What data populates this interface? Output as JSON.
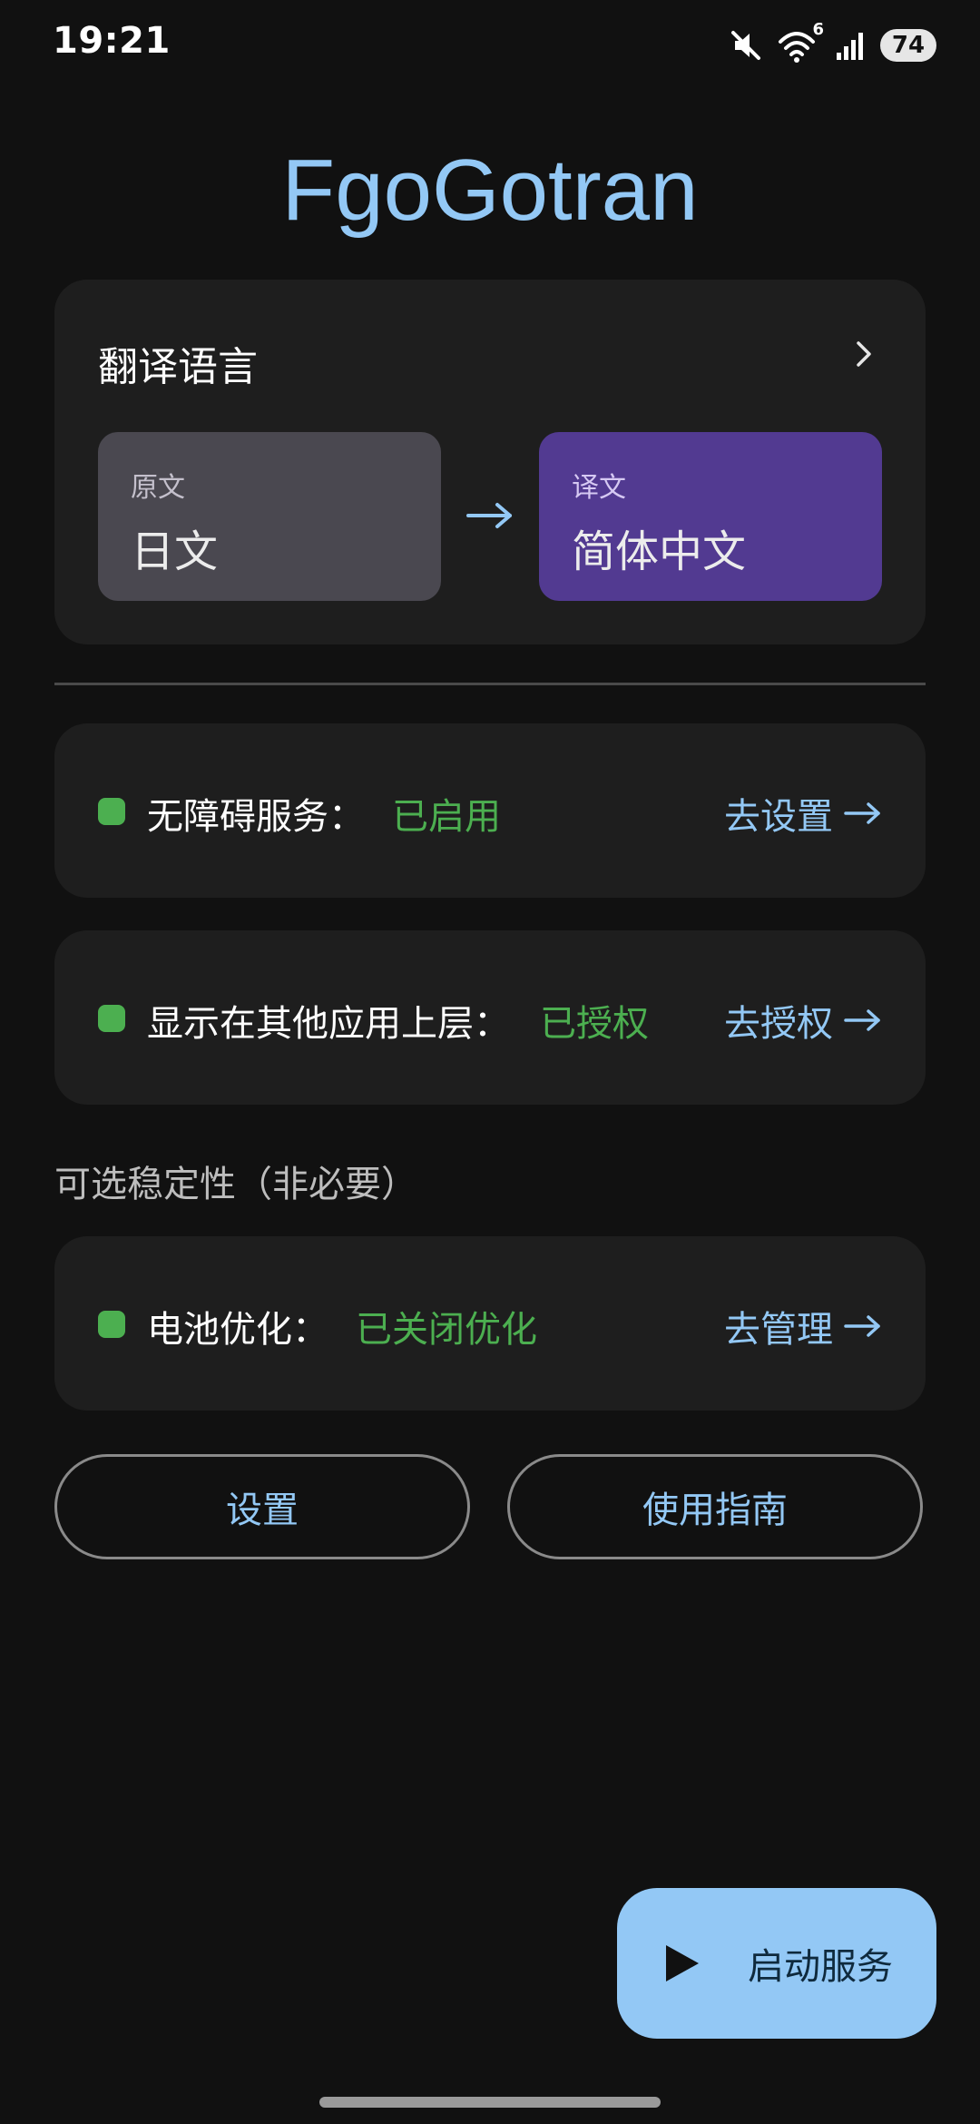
{
  "status_bar": {
    "time": "19:21",
    "battery": "74",
    "wifi_badge": "6",
    "icons": [
      "mute-icon",
      "wifi-icon",
      "signal-icon",
      "battery-icon"
    ]
  },
  "app": {
    "title": "FgoGotran"
  },
  "language_card": {
    "header": "翻译语言",
    "source_label": "原文",
    "source_value": "日文",
    "target_label": "译文",
    "target_value": "简体中文"
  },
  "permissions": {
    "accessibility": {
      "label": "无障碍服务：",
      "value": "已启用",
      "action": "去设置"
    },
    "overlay": {
      "label": "显示在其他应用上层：",
      "value": "已授权",
      "action": "去授权"
    }
  },
  "optional_section": {
    "title": "可选稳定性（非必要）",
    "battery": {
      "label": "电池优化：",
      "value": "已关闭优化",
      "action": "去管理"
    }
  },
  "buttons": {
    "settings": "设置",
    "guide": "使用指南",
    "start_service": "启动服务"
  },
  "colors": {
    "accent": "#93c8f5",
    "status_ok": "#4caf50",
    "target_box": "#523a91",
    "source_box": "#4a4850",
    "card_bg": "#1e1e1e",
    "page_bg": "#111111"
  }
}
